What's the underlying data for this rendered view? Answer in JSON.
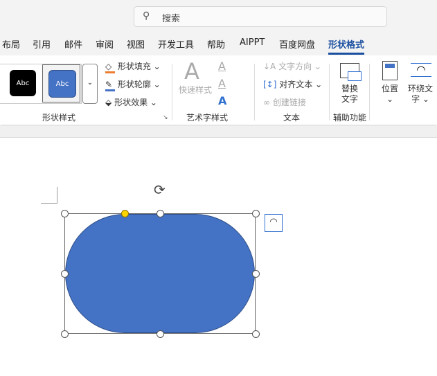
{
  "search": {
    "placeholder": "搜索",
    "icon": "search-icon"
  },
  "tabs": [
    "布局",
    "引用",
    "邮件",
    "审阅",
    "视图",
    "开发工具",
    "帮助",
    "AIPPT",
    "百度网盘",
    "形状格式"
  ],
  "active_tab": "形状格式",
  "shape_styles": {
    "swatch1": "Abc",
    "swatch2": "Abc",
    "fill": "形状填充",
    "outline": "形状轮廓",
    "effects": "形状效果",
    "group": "形状样式"
  },
  "wordart": {
    "quick": "快速样式",
    "group": "艺术字样式"
  },
  "text": {
    "direction": "文字方向",
    "align": "对齐文本",
    "link": "创建链接",
    "group": "文本"
  },
  "accessibility": {
    "alt1": "替换",
    "alt2": "文字",
    "group": "辅助功能"
  },
  "arrange": {
    "position": "位置",
    "wrap1": "环绕文",
    "wrap2": "字"
  },
  "colors": {
    "shape_fill": "#4472c4",
    "accent": "#1a4fa0",
    "fill_bar": "#ed7d31",
    "outline_bar": "#4472c4"
  }
}
